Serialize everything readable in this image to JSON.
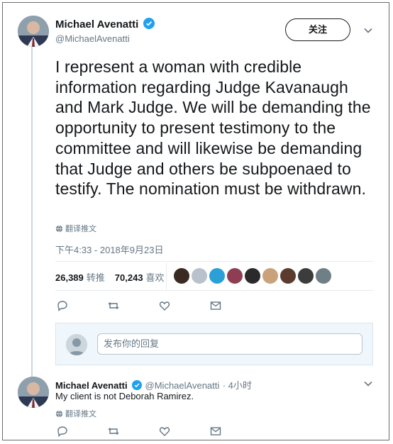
{
  "main_tweet": {
    "author_name": "Michael Avenatti",
    "author_handle": "@MichaelAvenatti",
    "follow_label": "关注",
    "text": "I represent a woman with credible information regarding Judge Kavanaugh and Mark Judge. We will be demanding the opportunity to present testimony to the committee and will likewise be demanding that Judge and others be subpoenaed to testify. The nomination must be withdrawn.",
    "translate_label": "翻译推文",
    "timestamp": "下午4:33 - 2018年9月23日",
    "retweets_count": "26,389",
    "retweets_label": "转推",
    "likes_count": "70,243",
    "likes_label": "喜欢",
    "liker_colors": [
      "#3b2a24",
      "#b9c2cc",
      "#2aa0d8",
      "#8e3d53",
      "#2a2a2a",
      "#caa27a",
      "#5a3b2e",
      "#3c3c3c",
      "#6f7f86"
    ]
  },
  "reply_composer": {
    "placeholder": "发布你的回复"
  },
  "reply_tweet": {
    "author_name": "Michael Avenatti",
    "author_handle": "@MichaelAvenatti",
    "time_ago": "· 4小时",
    "text": "My client is not Deborah Ramirez.",
    "translate_label": "翻译推文"
  },
  "colors": {
    "verified": "#1da1f2",
    "muted": "#657786"
  }
}
